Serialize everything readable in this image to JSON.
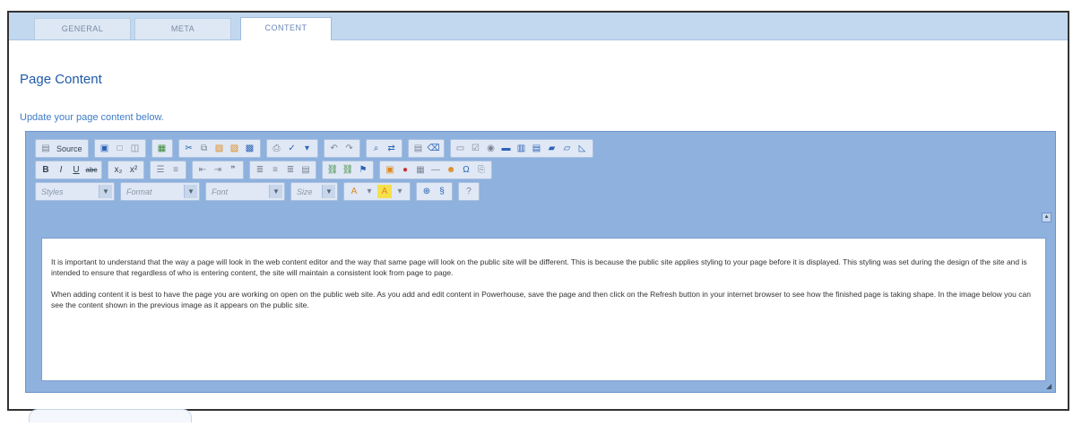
{
  "tabs": [
    {
      "label": "GENERAL"
    },
    {
      "label": "META"
    },
    {
      "label": "CONTENT"
    }
  ],
  "page_title": "Page Content",
  "subtitle": "Update your page content below.",
  "toolbar": {
    "source_label": "Source",
    "combos": {
      "styles": "Styles",
      "format": "Format",
      "font": "Font",
      "size": "Size"
    },
    "glyphs": {
      "bold": "B",
      "italic": "I",
      "underline": "U",
      "strike": "abc",
      "subscript": "x₂",
      "superscript": "x²"
    }
  },
  "content": {
    "paragraphs": [
      "It is important to understand that the way a page will look in the web content editor and the way that same page will look on the public site will be different. This is because the public site applies styling to your page before it is displayed. This styling was set during the design of the site and is intended to ensure that regardless of who is entering content, the site will maintain a consistent look from page to page.",
      "When adding content it is best to have the page you are working on open on the public web site. As you add and edit content in Powerhouse, save the page and then click on the Refresh button in your internet browser to see how the finished page is taking shape. In the image below you can see the content shown in the previous image as it appears on the public site."
    ]
  }
}
